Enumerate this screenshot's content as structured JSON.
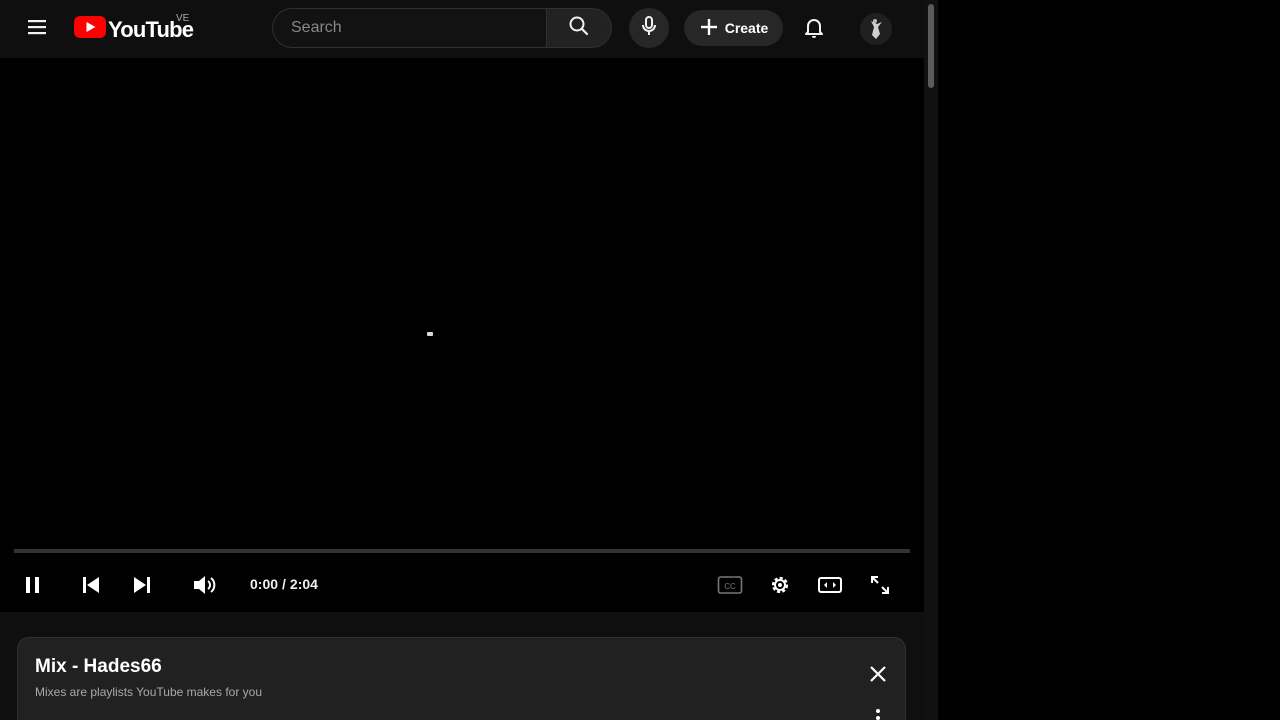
{
  "masthead": {
    "logo_text": "YouTube",
    "region_code": "VE",
    "search_placeholder": "Search",
    "create_label": "Create",
    "icons": [
      "menu-icon",
      "youtube-logo-icon",
      "search-icon",
      "microphone-icon",
      "plus-icon",
      "bell-icon",
      "avatar"
    ]
  },
  "player": {
    "current_time": "0:00",
    "separator": "/",
    "duration": "2:04",
    "progress": 0,
    "controls": [
      "pause-icon",
      "previous-icon",
      "next-icon",
      "volume-icon",
      "captions-icon",
      "settings-icon",
      "theater-mode-icon",
      "fullscreen-icon"
    ]
  },
  "playlist_panel": {
    "title": "Mix - Hades66",
    "subtitle": "Mixes are playlists YouTube makes for you"
  },
  "colors": {
    "background": "#0f0f0f",
    "player_background": "#000000",
    "brand_red": "#ff0000",
    "panel_background": "#212121",
    "text_primary": "#f1f1f1",
    "text_secondary": "#aaaaaa"
  }
}
